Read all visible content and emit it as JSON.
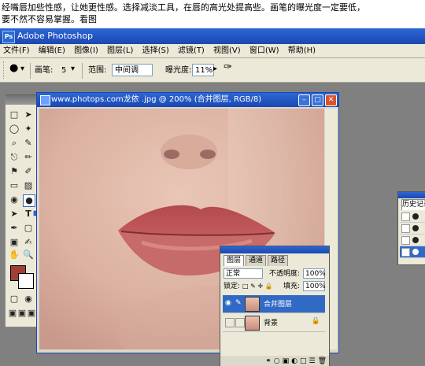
{
  "caption": {
    "line1": "经嘴唇加些性感，让她更性感。选择减淡工具，在唇的高光处提高些。画笔的曝光度一定要低，",
    "line2": "要不然不容易掌握。看图"
  },
  "app": {
    "title": "Adobe Photoshop",
    "logo": "Ps",
    "menu": [
      "文件(F)",
      "编辑(E)",
      "图像(I)",
      "图层(L)",
      "选择(S)",
      "滤镜(T)",
      "视图(V)",
      "窗口(W)",
      "帮助(H)"
    ]
  },
  "options_bar": {
    "brush_label": "画笔:",
    "brush_size": "5",
    "range_label": "范围:",
    "range_value": "中间调",
    "exposure_label": "曝光度:",
    "exposure_value": "11%"
  },
  "document": {
    "title": "www.photops.com龙依 .jpg @ 200% (合并图层, RGB/8)"
  },
  "layers_panel": {
    "tabs": [
      "图层",
      "通道",
      "路径"
    ],
    "blend_mode": "正常",
    "opacity_label": "不透明度:",
    "opacity_value": "100%",
    "lock_label": "锁定:",
    "fill_label": "填充:",
    "fill_value": "100%",
    "layers": [
      {
        "name": "合并图层",
        "selected": true
      },
      {
        "name": "背景",
        "selected": false
      }
    ]
  },
  "history_panel": {
    "tab": "历史记录"
  },
  "colors": {
    "foreground": "#a23e37",
    "background": "#ffffff",
    "titlebar": "#2256c5",
    "workspace": "#808080"
  },
  "icons": {
    "pointing_arrow": "arrow-right-icon",
    "dodge_tool": "dodge-tool-icon"
  }
}
